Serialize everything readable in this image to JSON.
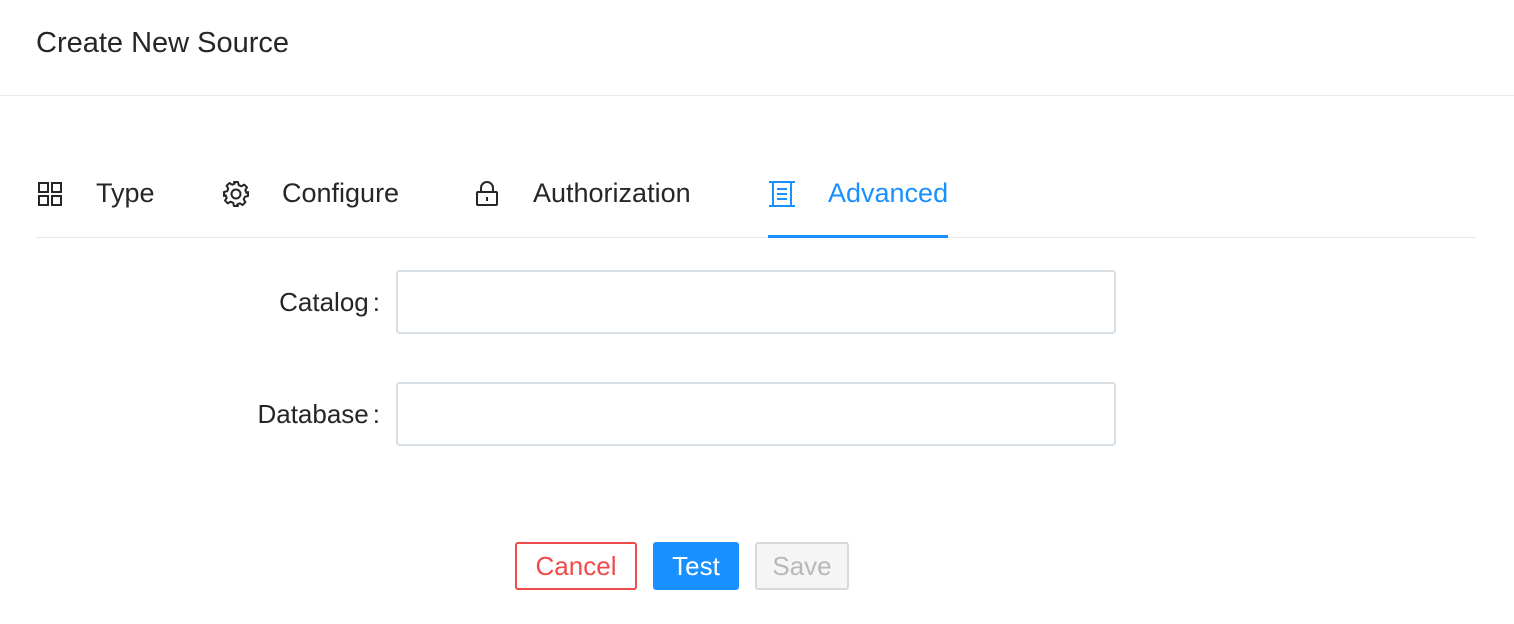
{
  "header": {
    "title": "Create New Source"
  },
  "tabs": [
    {
      "label": "Type",
      "icon": "appstore-icon",
      "active": false
    },
    {
      "label": "Configure",
      "icon": "gear-icon",
      "active": false
    },
    {
      "label": "Authorization",
      "icon": "lock-icon",
      "active": false
    },
    {
      "label": "Advanced",
      "icon": "container-icon",
      "active": true
    }
  ],
  "form": {
    "catalog": {
      "label": "Catalog",
      "value": "",
      "placeholder": ""
    },
    "database": {
      "label": "Database",
      "value": "",
      "placeholder": ""
    },
    "colon": ":"
  },
  "buttons": {
    "cancel": "Cancel",
    "test": "Test",
    "save": "Save"
  },
  "colors": {
    "accent": "#1890ff",
    "danger": "#f04b4b",
    "disabled_text": "#b8b8b8",
    "text": "#262626"
  }
}
